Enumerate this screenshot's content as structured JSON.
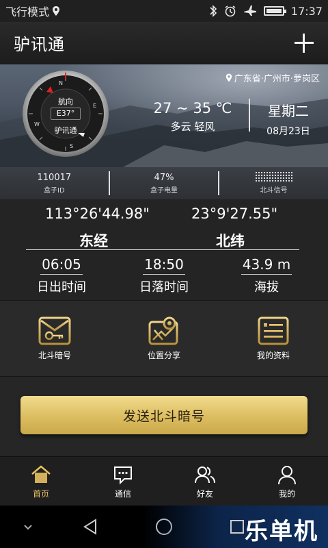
{
  "status_bar": {
    "airplane_mode_label": "飞行模式",
    "time": "17:37",
    "icons": [
      "location-icon",
      "bluetooth-icon",
      "alarm-icon",
      "airplane-icon",
      "battery-icon"
    ]
  },
  "header": {
    "title": "驴讯通",
    "add_icon": "plus-icon"
  },
  "hero": {
    "location": "广东省·广州市·萝岗区",
    "compass": {
      "heading_label": "航向",
      "heading_value": "E37°",
      "brand": "驴讯通",
      "cardinals": [
        "N",
        "E",
        "S",
        "W"
      ]
    },
    "weather": {
      "temp_range": "27 ~ 35 ℃",
      "condition": "多云  轻风"
    },
    "date": {
      "weekday": "星期二",
      "date": "08月23日"
    }
  },
  "info": {
    "box_id_value": "110017",
    "box_id_label": "盒子ID",
    "battery_value": "47%",
    "battery_label": "盒子电量",
    "signal_label": "北斗信号"
  },
  "coordinates": {
    "longitude": "113°26'44.98\"",
    "latitude": "23°9'27.55\"",
    "longitude_label": "东经",
    "latitude_label": "北纬",
    "sunrise_value": "06:05",
    "sunrise_label": "日出时间",
    "sunset_value": "18:50",
    "sunset_label": "日落时间",
    "altitude_value": "43.9 m",
    "altitude_label": "海拔"
  },
  "actions": [
    {
      "label": "北斗暗号",
      "icon": "envelope-key-icon"
    },
    {
      "label": "位置分享",
      "icon": "map-share-icon"
    },
    {
      "label": "我的资料",
      "icon": "profile-card-icon"
    }
  ],
  "send_button": "发送北斗暗号",
  "tabs": [
    {
      "label": "首页",
      "icon": "home-icon",
      "active": true
    },
    {
      "label": "通信",
      "icon": "chat-icon",
      "active": false
    },
    {
      "label": "好友",
      "icon": "friends-icon",
      "active": false
    },
    {
      "label": "我的",
      "icon": "user-icon",
      "active": false
    }
  ],
  "watermark": "乐单机",
  "colors": {
    "accent_gold": "#e7c163",
    "button_gold": "#dcbd60",
    "background": "#1c1c1c"
  }
}
